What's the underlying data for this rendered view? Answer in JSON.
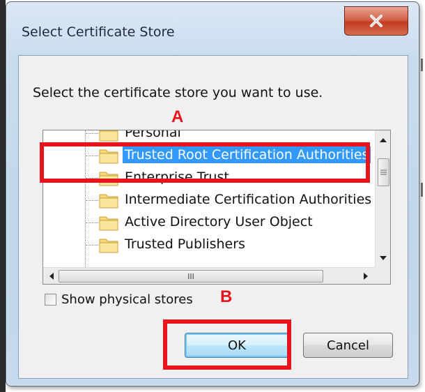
{
  "dialog": {
    "title": "Select Certificate Store",
    "close_icon": "close-icon",
    "instruction": "Select the certificate store you want to use."
  },
  "tree": {
    "items": [
      {
        "label": "Personal",
        "selected": false
      },
      {
        "label": "Trusted Root Certification Authorities",
        "selected": true
      },
      {
        "label": "Enterprise Trust",
        "selected": false
      },
      {
        "label": "Intermediate Certification Authorities",
        "selected": false
      },
      {
        "label": "Active Directory User Object",
        "selected": false
      },
      {
        "label": "Trusted Publishers",
        "selected": false
      }
    ],
    "hscroll_grip": "III"
  },
  "checkbox": {
    "label": "Show physical stores",
    "checked": false
  },
  "buttons": {
    "ok": "OK",
    "cancel": "Cancel"
  },
  "annotations": {
    "a": "A",
    "b": "B",
    "color": "#e8141d"
  },
  "colors": {
    "selection": "#3399ff",
    "close_button": "#c43c22"
  }
}
